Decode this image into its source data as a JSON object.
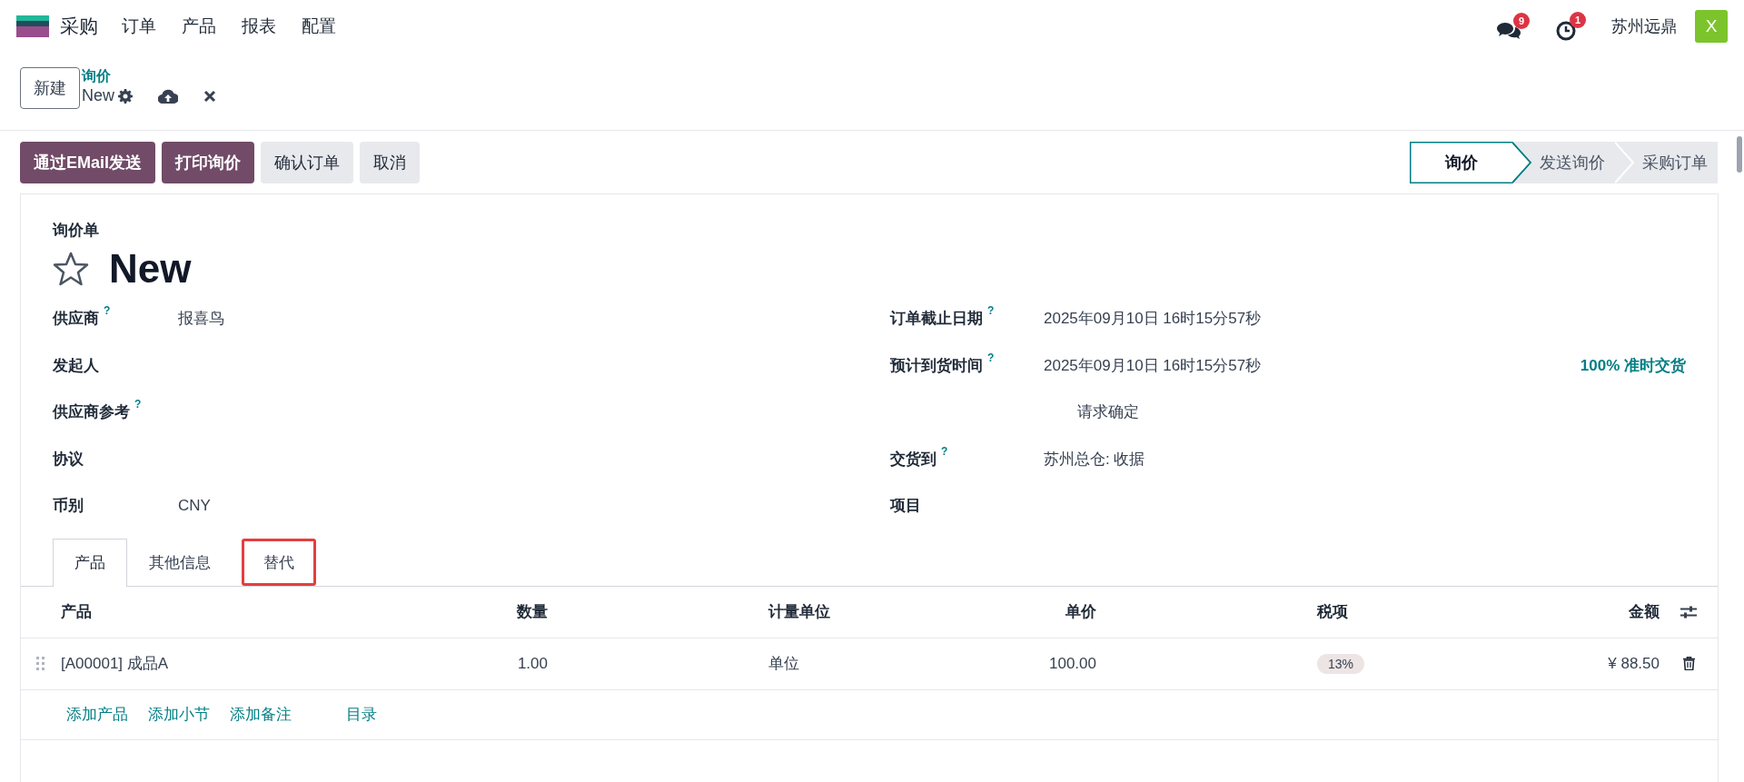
{
  "navbar": {
    "app_name": "采购",
    "menus": [
      "订单",
      "产品",
      "报表",
      "配置"
    ],
    "messages_badge": "9",
    "activities_badge": "1",
    "company": "苏州远鼎",
    "avatar_letter": "X"
  },
  "control_panel": {
    "new_button": "新建",
    "breadcrumb": "询价",
    "record_name": "New"
  },
  "actions": [
    {
      "label": "通过EMail发送",
      "kind": "primary"
    },
    {
      "label": "打印询价",
      "kind": "primary"
    },
    {
      "label": "确认订单",
      "kind": "secondary"
    },
    {
      "label": "取消",
      "kind": "secondary"
    }
  ],
  "status_steps": [
    {
      "label": "询价",
      "selected": true
    },
    {
      "label": "发送询价",
      "selected": false
    },
    {
      "label": "采购订单",
      "selected": false
    }
  ],
  "form": {
    "type_label": "询价单",
    "title": "New",
    "starred": false,
    "left_fields": [
      {
        "label": "供应商",
        "help": "?",
        "value": "报喜鸟"
      },
      {
        "label": "发起人"
      },
      {
        "label": "供应商参考",
        "help": "?"
      },
      {
        "label": "协议"
      },
      {
        "label": "币别",
        "value": "CNY"
      }
    ],
    "right_fields": [
      {
        "kind": "field",
        "label": "订单截止日期",
        "help": "?",
        "value": "2025年09月10日 16时15分57秒"
      },
      {
        "kind": "field",
        "label": "预计到货时间",
        "help": "?",
        "value": "2025年09月10日 16时15分57秒",
        "extra": "100% 准时交货"
      },
      {
        "kind": "note",
        "value": "请求确定"
      },
      {
        "kind": "field",
        "label": "交货到",
        "help": "?",
        "value": "苏州总仓: 收据"
      },
      {
        "kind": "field",
        "label": "项目"
      }
    ]
  },
  "tabs": [
    {
      "label": "产品",
      "selected": true,
      "highlighted": false
    },
    {
      "label": "其他信息",
      "selected": false,
      "highlighted": false
    },
    {
      "label": "替代",
      "selected": false,
      "highlighted": true
    }
  ],
  "table": {
    "columns": [
      "产品",
      "数量",
      "计量单位",
      "单价",
      "税项",
      "金额"
    ],
    "rows": [
      {
        "product": "[A00001] 成品A",
        "quantity": "1.00",
        "uom": "单位",
        "unit_price": "100.00",
        "tax": "13%",
        "amount": "¥ 88.50"
      }
    ],
    "add_links": [
      "添加产品",
      "添加小节",
      "添加备注",
      "目录"
    ]
  }
}
